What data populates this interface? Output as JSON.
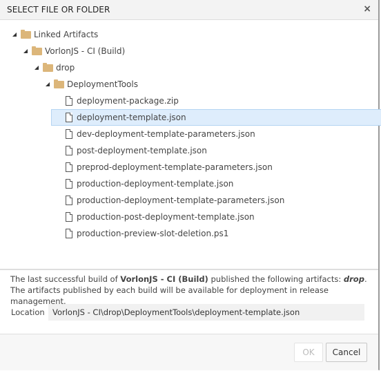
{
  "dialog": {
    "title": "SELECT FILE OR FOLDER",
    "close_glyph": "×"
  },
  "tree": {
    "nodes": [
      {
        "label": "Linked Artifacts",
        "type": "folder",
        "expanded": true,
        "level": 0
      },
      {
        "label": "VorlonJS - CI (Build)",
        "type": "folder",
        "expanded": true,
        "level": 1
      },
      {
        "label": "drop",
        "type": "folder",
        "expanded": true,
        "level": 2
      },
      {
        "label": "DeploymentTools",
        "type": "folder",
        "expanded": true,
        "level": 3
      },
      {
        "label": "deployment-package.zip",
        "type": "file",
        "level": 4,
        "selected": false
      },
      {
        "label": "deployment-template.json",
        "type": "file",
        "level": 4,
        "selected": true
      },
      {
        "label": "dev-deployment-template-parameters.json",
        "type": "file",
        "level": 4,
        "selected": false
      },
      {
        "label": "post-deployment-template.json",
        "type": "file",
        "level": 4,
        "selected": false
      },
      {
        "label": "preprod-deployment-template-parameters.json",
        "type": "file",
        "level": 4,
        "selected": false
      },
      {
        "label": "production-deployment-template.json",
        "type": "file",
        "level": 4,
        "selected": false
      },
      {
        "label": "production-deployment-template-parameters.json",
        "type": "file",
        "level": 4,
        "selected": false
      },
      {
        "label": "production-post-deployment-template.json",
        "type": "file",
        "level": 4,
        "selected": false
      },
      {
        "label": "production-preview-slot-deletion.ps1",
        "type": "file",
        "level": 4,
        "selected": false
      }
    ]
  },
  "info": {
    "prefix": "The last successful build of ",
    "build_name": "VorlonJS - CI (Build)",
    "middle": " published the following artifacts: ",
    "artifact": "drop",
    "suffix": ". The artifacts published by each build will be available for deployment in release management."
  },
  "location": {
    "label": "Location",
    "value": "VorlonJS - CI\\drop\\DeploymentTools\\deployment-template.json"
  },
  "footer": {
    "ok_label": "OK",
    "ok_enabled": false,
    "cancel_label": "Cancel"
  },
  "colors": {
    "folder": "#dcb67a",
    "selection_bg": "#deedfc",
    "selection_border": "#b4d4f2"
  }
}
